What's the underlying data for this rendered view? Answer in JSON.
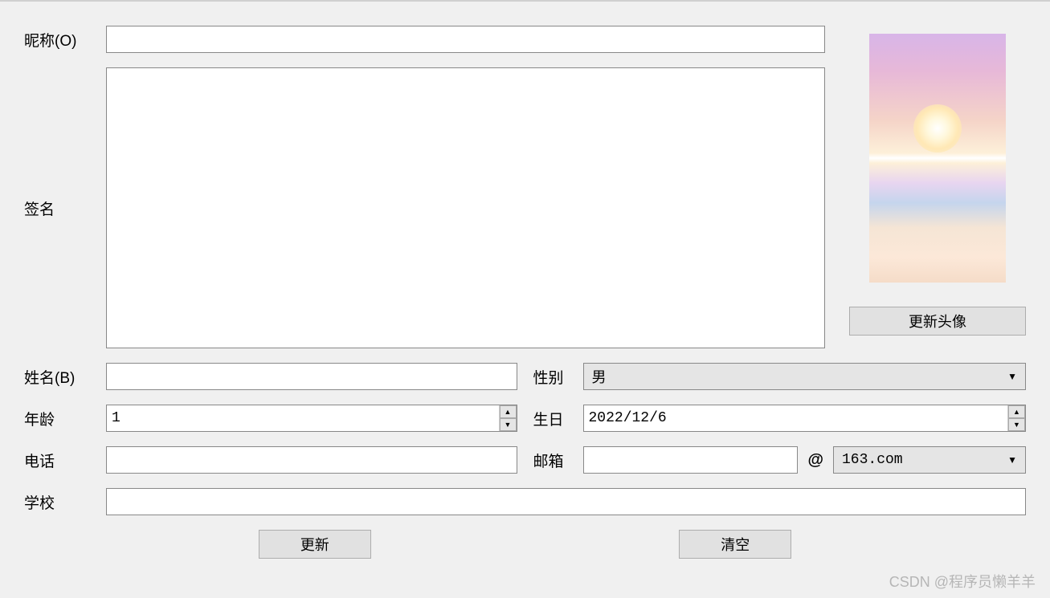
{
  "labels": {
    "nickname": "昵称(O)",
    "signature": "签名",
    "name": "姓名(B)",
    "gender": "性别",
    "age": "年龄",
    "birthday": "生日",
    "phone": "电话",
    "email": "邮箱",
    "school": "学校"
  },
  "values": {
    "nickname": "",
    "signature": "",
    "name": "",
    "gender_selected": "男",
    "age": "1",
    "birthday": "2022/12/6",
    "phone": "",
    "email_user": "",
    "email_domain_selected": "163.com",
    "school": ""
  },
  "symbols": {
    "at": "@",
    "up": "▲",
    "down": "▼"
  },
  "buttons": {
    "update_avatar": "更新头像",
    "update": "更新",
    "clear": "清空"
  },
  "watermark": "CSDN @程序员懒羊羊"
}
